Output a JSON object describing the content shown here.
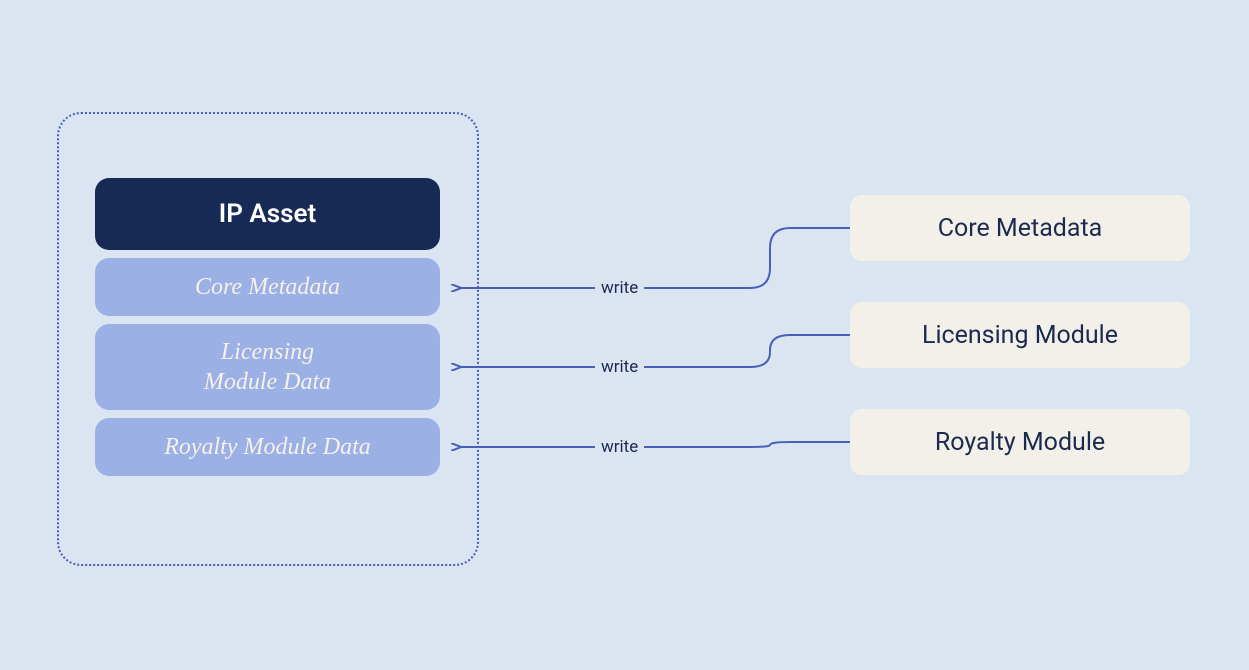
{
  "container": {
    "title": "IP Asset",
    "data_boxes": {
      "core": "Core Metadata",
      "licensing": "Licensing\nModule Data",
      "royalty": "Royalty Module Data"
    }
  },
  "modules": {
    "core": "Core Metadata",
    "licensing": "Licensing Module",
    "royalty": "Royalty Module"
  },
  "edge_label": "write"
}
